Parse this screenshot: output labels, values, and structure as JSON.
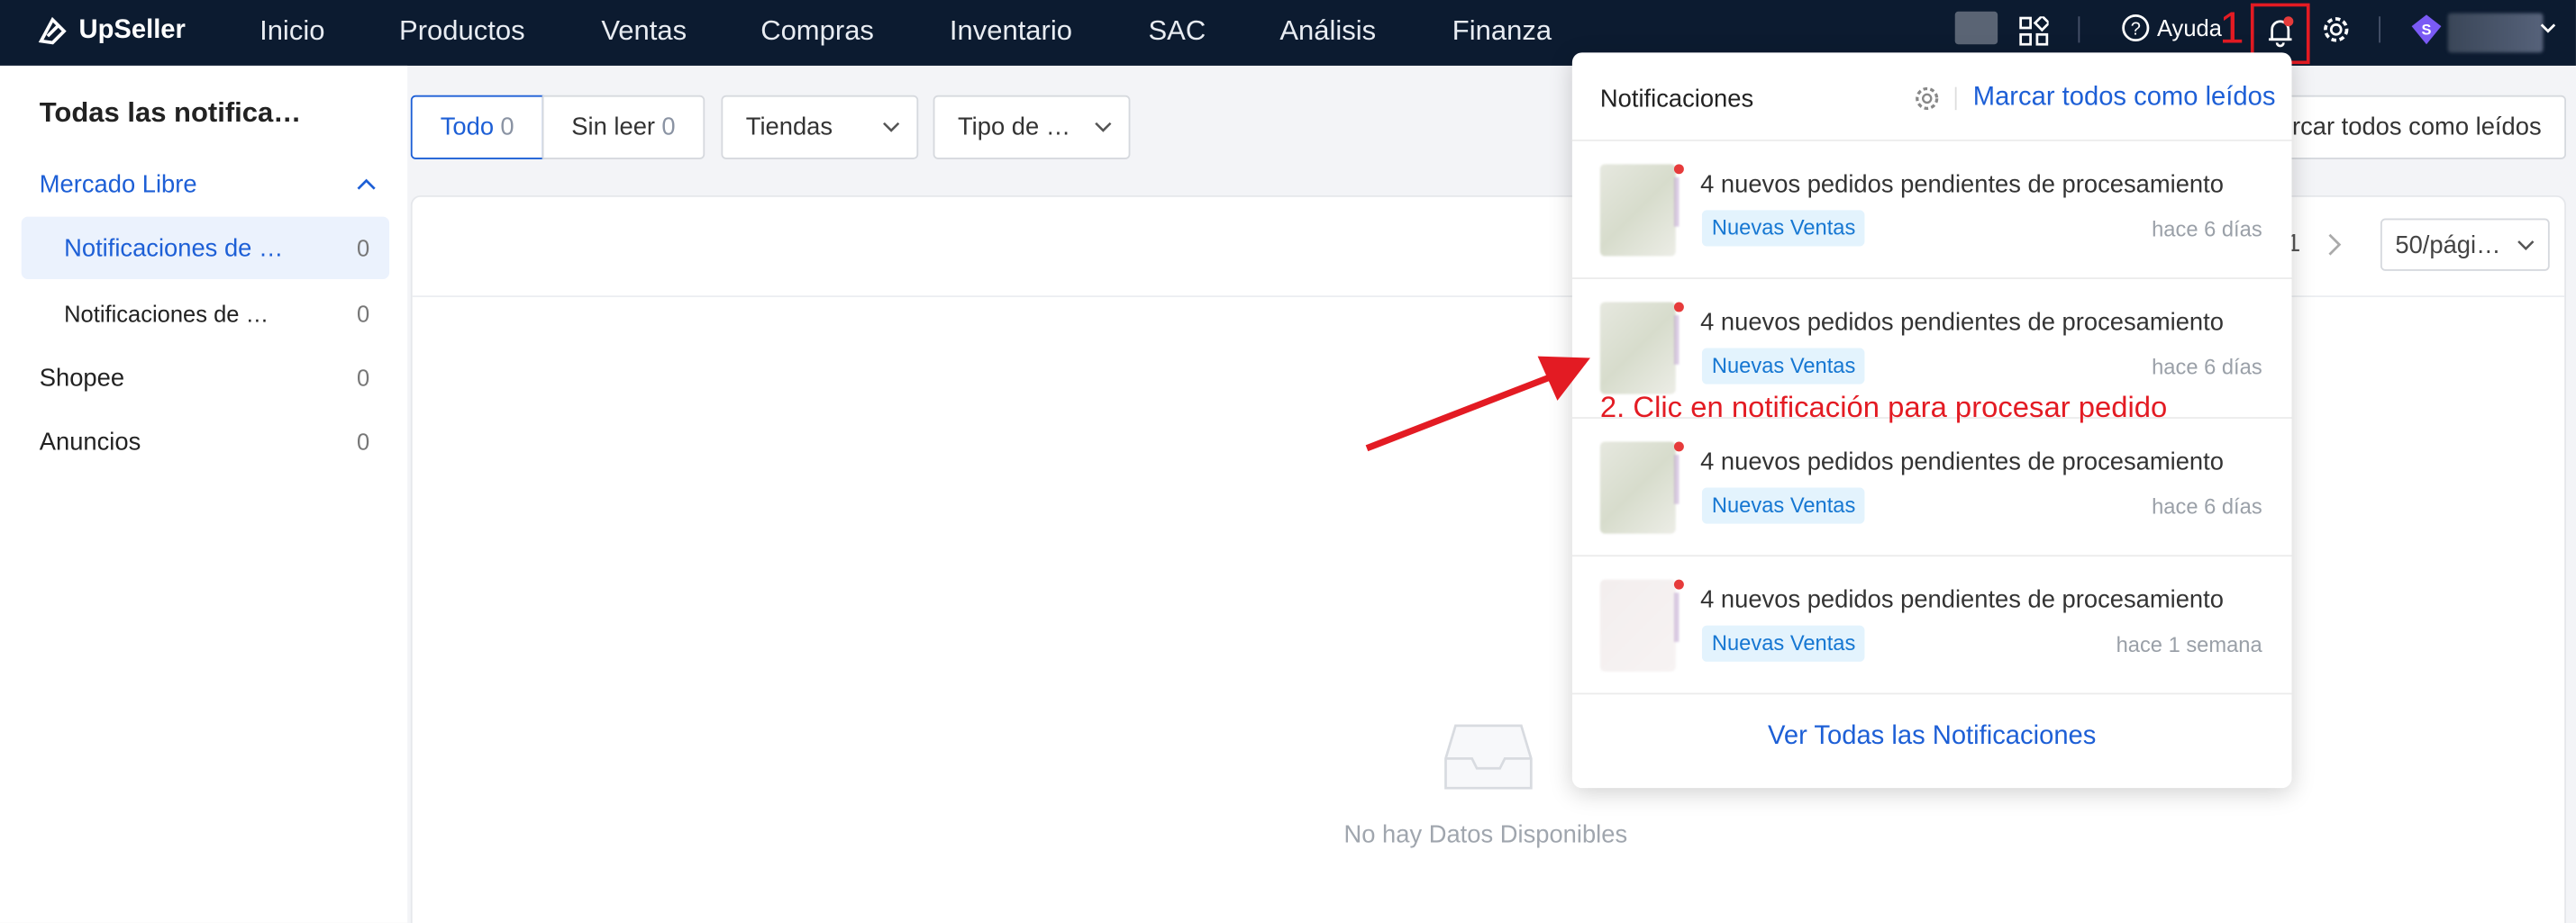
{
  "nav": {
    "brand": "UpSeller",
    "items": [
      "Inicio",
      "Productos",
      "Ventas",
      "Compras",
      "Inventario",
      "SAC",
      "Análisis",
      "Finanza"
    ],
    "help": "Ayuda",
    "avatar_letter": "S"
  },
  "annotations": {
    "step1": "1",
    "step2": "2. Clic en notificación para procesar pedido",
    "color": "#e31b23"
  },
  "sidebar": {
    "title": "Todas las notifica…",
    "groups": [
      {
        "label": "Mercado Libre",
        "expanded": true
      },
      {
        "label": "Notificaciones de …",
        "count": "0",
        "selected": true
      },
      {
        "label": "Notificaciones de …",
        "count": "0"
      },
      {
        "label": "Shopee",
        "count": "0"
      },
      {
        "label": "Anuncios",
        "count": "0"
      }
    ]
  },
  "filters": {
    "tab_all": "Todo",
    "tab_all_count": "0",
    "tab_unread": "Sin leer",
    "tab_unread_count": "0",
    "stores": "Tiendas",
    "type": "Tipo de …",
    "mark_all_partial": "rcar todos como leídos"
  },
  "pagination": {
    "page": "1",
    "page_size": "50/pági…"
  },
  "empty": {
    "text": "No hay Datos Disponibles"
  },
  "dropdown": {
    "title": "Notificaciones",
    "mark_all": "Marcar todos como leídos",
    "items": [
      {
        "text": "4 nuevos pedidos pendientes de procesamiento",
        "tag": "Nuevas Ventas",
        "time": "hace 6 días"
      },
      {
        "text": "4 nuevos pedidos pendientes de procesamiento",
        "tag": "Nuevas Ventas",
        "time": "hace 6 días"
      },
      {
        "text": "4 nuevos pedidos pendientes de procesamiento",
        "tag": "Nuevas Ventas",
        "time": "hace 6 días"
      },
      {
        "text": "4 nuevos pedidos pendientes de procesamiento",
        "tag": "Nuevas Ventas",
        "time": "hace 1 semana"
      }
    ],
    "view_all": "Ver Todas las Notificaciones"
  },
  "colors": {
    "nav_bg": "#0c1b30",
    "accent": "#1d5fd6",
    "tag_bg": "#e3f3fd",
    "unread_dot": "#e63b3b"
  }
}
